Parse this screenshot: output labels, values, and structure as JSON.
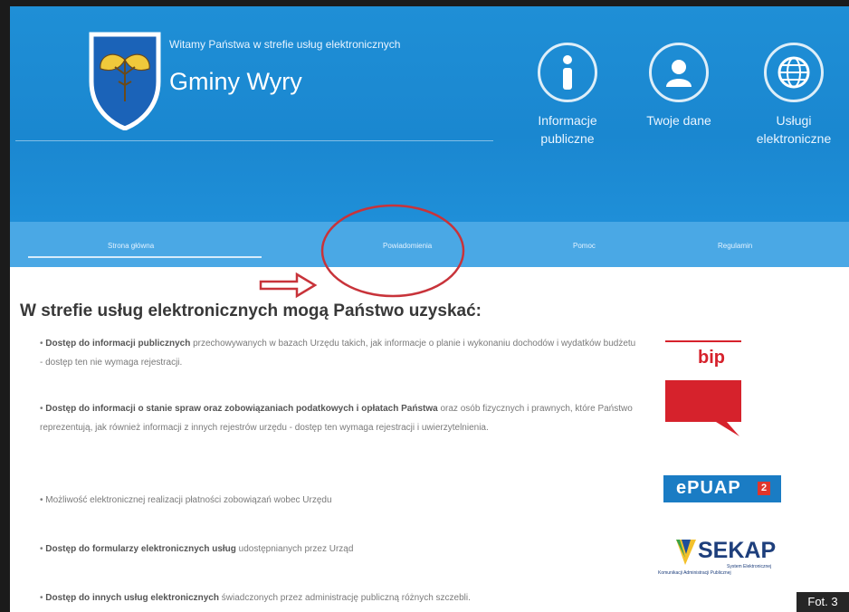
{
  "header": {
    "welcome": "Witamy Państwa w strefie usług elektronicznych",
    "town": "Gminy Wyry"
  },
  "nav_icons": [
    {
      "label_line1": "Informacje",
      "label_line2": "publiczne",
      "icon": "info-icon"
    },
    {
      "label_line1": "Twoje dane",
      "label_line2": "",
      "icon": "user-icon"
    },
    {
      "label_line1": "Usługi",
      "label_line2": "elektroniczne",
      "icon": "globe-icon"
    }
  ],
  "menu": {
    "items": [
      "Strona główna",
      "Powiadomienia",
      "Pomoc",
      "Regulamin"
    ]
  },
  "content": {
    "title": "W strefie usług elektronicznych mogą Państwo uzyskać:",
    "items": [
      {
        "bold": "Dostęp do informacji publicznych",
        "rest": " przechowywanych w bazach Urzędu takich, jak informacje o planie i wykonaniu dochodów i wydatków budżetu - dostęp ten nie wymaga rejestracji."
      },
      {
        "bold": "Dostęp do informacji o stanie spraw oraz zobowiązaniach podatkowych i opłatach Państwa",
        "rest": " oraz osób fizycznych i prawnych, które Państwo reprezentują, jak również informacji z innych rejestrów urzędu - dostęp ten wymaga rejestracji i uwierzytelnienia."
      },
      {
        "bold": "",
        "rest": "Możliwość elektronicznej realizacji płatności zobowiązań wobec Urzędu"
      },
      {
        "bold": "Dostęp do formularzy elektronicznych usług",
        "rest": " udostępnianych przez Urząd"
      },
      {
        "bold": "Dostęp do innych usług elektronicznych",
        "rest": " świadczonych przez administrację publiczną różnych szczebli."
      }
    ]
  },
  "logos": {
    "bip": "bip",
    "epuap": "ePUAP",
    "epuap_num": "2",
    "sekap": "SEKAP",
    "sekap_sub1": "System Elektronicznej",
    "sekap_sub2": "Komunikacji Administracji Publicznej"
  },
  "caption": "Fot. 3",
  "colors": {
    "header_blue": "#1a87d0",
    "menu_blue": "#4aa8e5",
    "annotation_red": "#c8333a",
    "bip_red": "#d6222c",
    "epuap_blue": "#1a7cc4"
  }
}
